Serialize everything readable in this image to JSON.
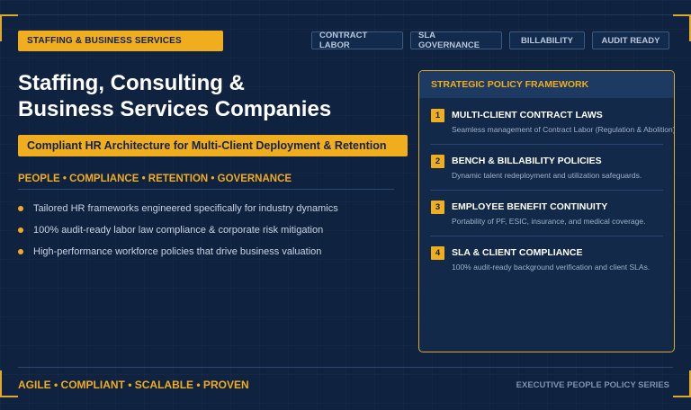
{
  "header": {
    "category_badge": "STAFFING & BUSINESS SERVICES",
    "tags": [
      "CONTRACT LABOR",
      "SLA GOVERNANCE",
      "BILLABILITY",
      "AUDIT READY"
    ]
  },
  "main": {
    "title_line1": "Staffing, Consulting &",
    "title_line2": "Business Services Companies",
    "subtitle": "Compliant HR Architecture for Multi-Client Deployment & Retention",
    "pillars": "PEOPLE • COMPLIANCE • RETENTION • GOVERNANCE",
    "bullets": [
      "Tailored HR frameworks engineered specifically for industry dynamics",
      "100% audit-ready labor law compliance & corporate risk mitigation",
      "High-performance workforce policies that drive business valuation"
    ]
  },
  "panel": {
    "heading": "STRATEGIC POLICY FRAMEWORK",
    "items": [
      {
        "num": "1",
        "title": "MULTI-CLIENT CONTRACT LAWS",
        "desc": "Seamless management of Contract Labor (Regulation & Abolition)."
      },
      {
        "num": "2",
        "title": "BENCH & BILLABILITY POLICIES",
        "desc": "Dynamic talent redeployment and utilization safeguards."
      },
      {
        "num": "3",
        "title": "EMPLOYEE BENEFIT CONTINUITY",
        "desc": "Portability of PF, ESIC, insurance, and medical coverage."
      },
      {
        "num": "4",
        "title": "SLA & CLIENT COMPLIANCE",
        "desc": "100% audit-ready background verification and client SLAs."
      }
    ]
  },
  "footer": {
    "left": "AGILE • COMPLIANT • SCALABLE • PROVEN",
    "right": "EXECUTIVE PEOPLE POLICY SERIES"
  },
  "colors": {
    "background": "#0f2240",
    "accent": "#f0ad1e",
    "panel": "#13294a"
  }
}
